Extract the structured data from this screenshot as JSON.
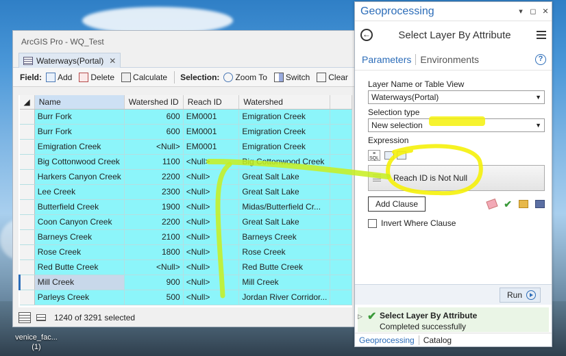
{
  "app": {
    "title": "ArcGIS Pro - WQ_Test",
    "doc_tab": "Waterways(Portal)",
    "doc_tab_close": "✕"
  },
  "toolbar": {
    "field_label": "Field:",
    "add": "Add",
    "delete": "Delete",
    "calculate": "Calculate",
    "selection_label": "Selection:",
    "zoom_to": "Zoom To",
    "switch": "Switch",
    "clear": "Clear"
  },
  "table": {
    "columns": [
      "Name",
      "Watershed ID",
      "Reach ID",
      "Watershed"
    ],
    "rows": [
      [
        "Burr Fork",
        "600",
        "EM0001",
        "Emigration Creek"
      ],
      [
        "Burr Fork",
        "600",
        "EM0001",
        "Emigration Creek"
      ],
      [
        "Emigration Creek",
        "<Null>",
        "EM0001",
        "Emigration Creek"
      ],
      [
        "Big Cottonwood Creek",
        "1100",
        "<Null>",
        "Big Cottonwood Creek"
      ],
      [
        "Harkers Canyon Creek",
        "2200",
        "<Null>",
        "Great Salt Lake"
      ],
      [
        "Lee Creek",
        "2300",
        "<Null>",
        "Great Salt Lake"
      ],
      [
        "Butterfield Creek",
        "1900",
        "<Null>",
        "Midas/Butterfield Cr..."
      ],
      [
        "Coon Canyon Creek",
        "2200",
        "<Null>",
        "Great Salt Lake"
      ],
      [
        "Barneys Creek",
        "2100",
        "<Null>",
        "Barneys Creek"
      ],
      [
        "Rose Creek",
        "1800",
        "<Null>",
        "Rose Creek"
      ],
      [
        "Red Butte Creek",
        "<Null>",
        "<Null>",
        "Red Butte Creek"
      ],
      [
        "Mill Creek",
        "900",
        "<Null>",
        "Mill Creek"
      ],
      [
        "Parleys Creek",
        "500",
        "<Null>",
        "Jordan River Corridor..."
      ]
    ],
    "status": "1240 of 3291 selected"
  },
  "desktop": {
    "icon_label": "venice_fac...",
    "icon_sub": "(1)"
  },
  "gp": {
    "title": "Geoprocessing",
    "ctl_pin": "▾",
    "ctl_dock": "◻",
    "ctl_close": "✕",
    "tool_title": "Select Layer By Attribute",
    "back": "←",
    "tab_parameters": "Parameters",
    "tab_environments": "Environments",
    "help": "?",
    "layer_label": "Layer Name or Table View",
    "layer_value": "Waterways(Portal)",
    "seltype_label": "Selection type",
    "seltype_value": "New selection",
    "expression_label": "Expression",
    "sql_label": "SQL",
    "clause_text": "Reach ID  is Not Null",
    "add_clause": "Add Clause",
    "invert_label": "Invert Where Clause",
    "run": "Run",
    "result_title": "Select Layer By Attribute",
    "result_status": "Completed successfully",
    "bottom_tab_gp": "Geoprocessing",
    "bottom_tab_catalog": "Catalog"
  },
  "colors": {
    "accent": "#2b6cb8",
    "selected_row": "#8cf5fa",
    "highlighter": "#f5f10a"
  }
}
